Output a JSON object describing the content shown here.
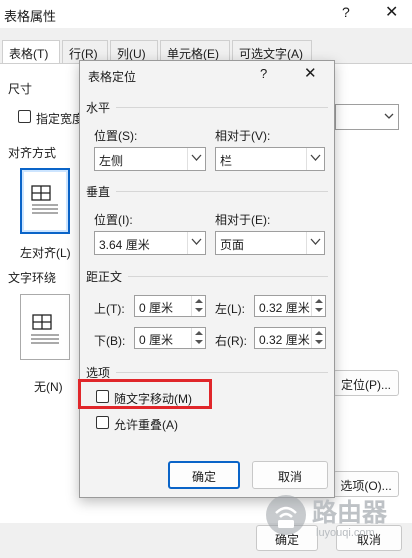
{
  "outer": {
    "title": "表格属性",
    "help_glyph": "?",
    "close_glyph": "✕",
    "tabs": [
      "表格(T)",
      "行(R)",
      "列(U)",
      "单元格(E)",
      "可选文字(A)"
    ],
    "size_label": "尺寸",
    "pref_width_label": "指定宽度",
    "alignment_label": "对齐方式",
    "align_left_label": "左对齐(L)",
    "wrap_label": "文字环绕",
    "wrap_none_label": "无(N)",
    "position_button": "定位(P)...",
    "options_button": "选项(O)...",
    "ok_button": "确定",
    "cancel_button": "取消"
  },
  "dialog": {
    "title": "表格定位",
    "help_glyph": "?",
    "close_glyph": "✕",
    "horizontal": {
      "group_label": "水平",
      "position_label": "位置(S):",
      "position_value": "左侧",
      "relative_label": "相对于(V):",
      "relative_value": "栏"
    },
    "vertical": {
      "group_label": "垂直",
      "position_label": "位置(I):",
      "position_value": "3.64 厘米",
      "relative_label": "相对于(E):",
      "relative_value": "页面"
    },
    "distance": {
      "group_label": "距正文",
      "top_label": "上(T):",
      "top_value": "0 厘米",
      "bottom_label": "下(B):",
      "bottom_value": "0 厘米",
      "left_label": "左(L):",
      "left_value": "0.32 厘米",
      "right_label": "右(R):",
      "right_value": "0.32 厘米"
    },
    "options": {
      "group_label": "选项",
      "move_with_text": "随文字移动(M)",
      "move_with_text_checked": false,
      "allow_overlap": "允许重叠(A)",
      "allow_overlap_checked": false
    },
    "ok_button": "确定",
    "cancel_button": "取消"
  },
  "watermark": {
    "text": "路由器",
    "subtext": "luyouqi.com"
  },
  "colors": {
    "accent": "#0a64c8",
    "highlight": "#e0262a"
  }
}
